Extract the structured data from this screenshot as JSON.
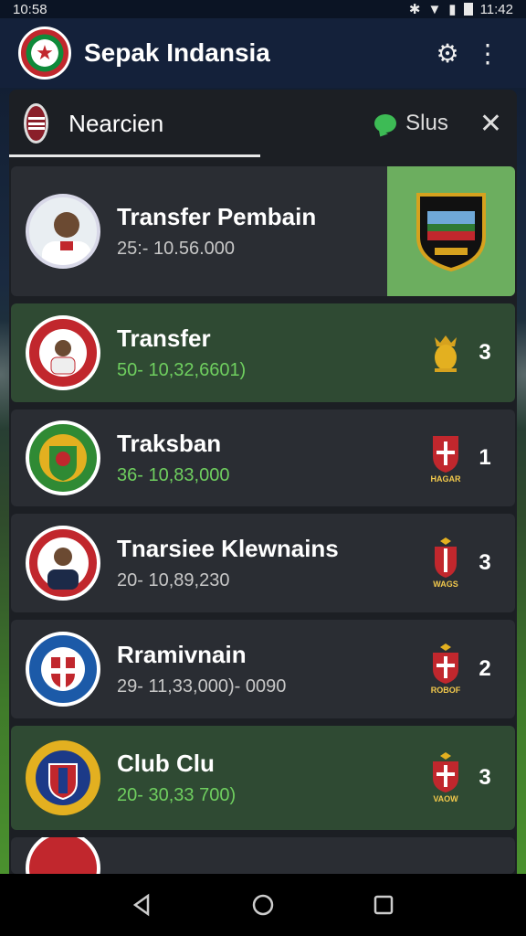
{
  "status_bar": {
    "time": "10:58",
    "clock": "11:42"
  },
  "app_bar": {
    "title": "Sepak Indansia",
    "settings_icon": "gear-icon",
    "menu_icon": "more-vert-icon"
  },
  "search": {
    "value": "Nearcien",
    "filter_label": "Slus",
    "close_icon": "close-icon"
  },
  "items": [
    {
      "name": "Transfer Pembain",
      "detail": "25:- 10.56.000",
      "count": "",
      "highlight": false,
      "green_tile": true
    },
    {
      "name": "Transfer",
      "detail": "50- 10,32,6601)",
      "count": "3",
      "highlight": true
    },
    {
      "name": "Traksban",
      "detail": "36- 10,83,000",
      "count": "1",
      "highlight": false
    },
    {
      "name": "Tnarsiee Klewnains",
      "detail": "20- 10,89,230",
      "count": "3",
      "highlight": false
    },
    {
      "name": "Rramivnain",
      "detail": "29- 11,33,000)- 0090",
      "count": "2",
      "highlight": false
    },
    {
      "name": "Club Clu",
      "detail": "20- 30,33 700)",
      "count": "3",
      "highlight": true
    }
  ],
  "crest_labels": [
    "HAGAR",
    "WAGS",
    "ROBOF",
    "VAOW"
  ],
  "colors": {
    "accent_red": "#c1272d",
    "accent_green": "#3dbb55",
    "tile_green": "#6cae5f"
  }
}
